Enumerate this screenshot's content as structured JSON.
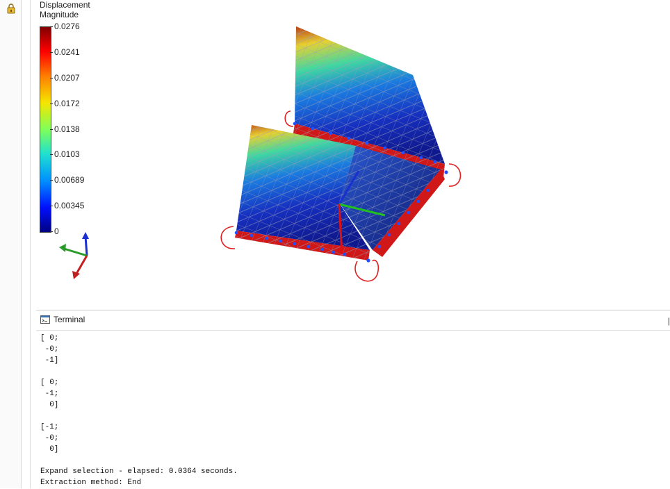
{
  "toolbar": {
    "lock_icon": "lock-icon"
  },
  "legend": {
    "title_line1": "Displacement",
    "title_line2": "Magnitude",
    "ticks": [
      "0.0276",
      "0.0241",
      "0.0207",
      "0.0172",
      "0.0138",
      "0.0103",
      "0.00689",
      "0.00345",
      "0"
    ]
  },
  "viewport": {
    "axes_icon": "xyz-axes-triad-icon",
    "model_icon": "fem-shell-mesh-icon"
  },
  "terminal": {
    "title": "Terminal",
    "icon": "terminal-icon",
    "lines": [
      "[ 0;",
      " -0;",
      " -1]",
      "",
      "[ 0;",
      " -1;",
      "  0]",
      "",
      "[-1;",
      " -0;",
      "  0]",
      "",
      "Expand selection - elapsed: 0.0364 seconds.",
      "Extraction method: End"
    ]
  }
}
